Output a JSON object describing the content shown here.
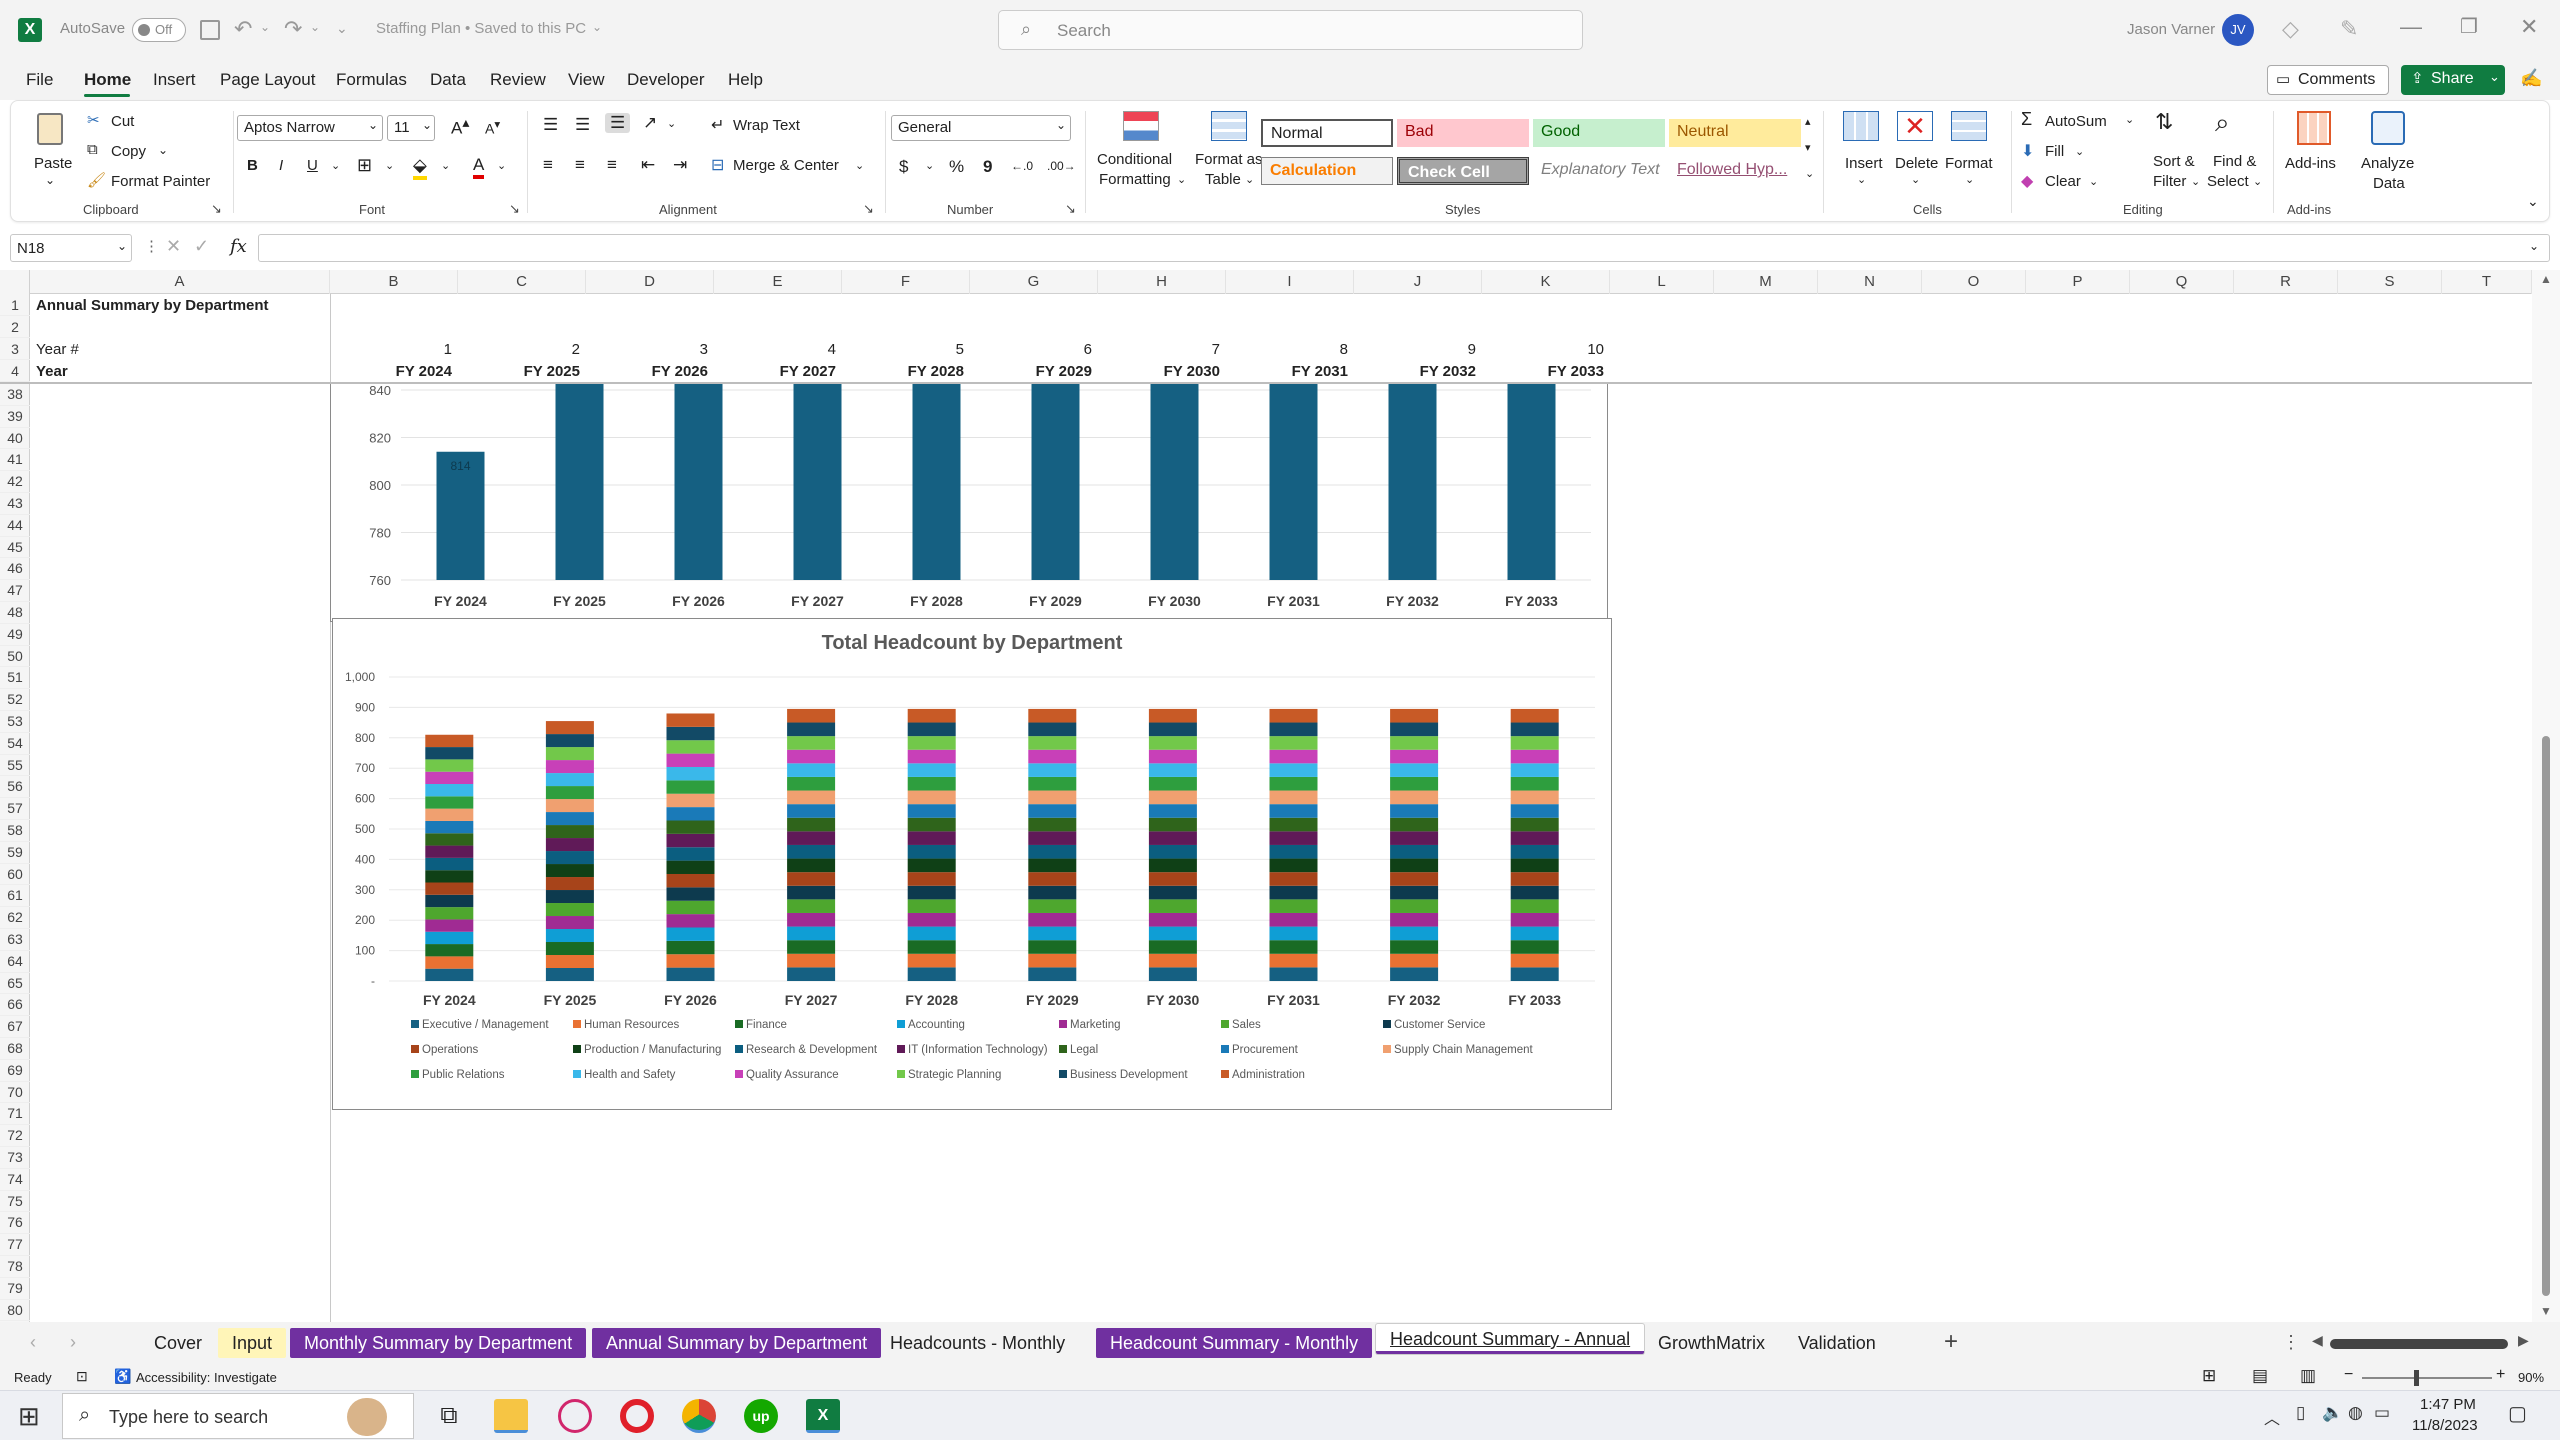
{
  "titlebar": {
    "autosave_label": "AutoSave",
    "autosave_state": "Off",
    "doc_title": "Staffing Plan • Saved to this PC",
    "search_placeholder": "Search",
    "user_name": "Jason Varner",
    "user_initials": "JV"
  },
  "menu": {
    "items": [
      "File",
      "Home",
      "Insert",
      "Page Layout",
      "Formulas",
      "Data",
      "Review",
      "View",
      "Developer",
      "Help"
    ],
    "active": "Home",
    "comments_label": "Comments",
    "share_label": "Share"
  },
  "ribbon": {
    "clipboard": {
      "group": "Clipboard",
      "paste": "Paste",
      "cut": "Cut",
      "copy": "Copy",
      "format_painter": "Format Painter"
    },
    "font": {
      "group": "Font",
      "font_name": "Aptos Narrow",
      "font_size": "11"
    },
    "alignment": {
      "group": "Alignment",
      "wrap_text": "Wrap Text",
      "merge_center": "Merge & Center"
    },
    "number": {
      "group": "Number",
      "format": "General"
    },
    "styles": {
      "group": "Styles",
      "conditional_1": "Conditional",
      "conditional_2": "Formatting",
      "format_table_1": "Format as",
      "format_table_2": "Table",
      "cells": [
        {
          "label": "Normal",
          "bg": "#ffffff",
          "fg": "#000000"
        },
        {
          "label": "Bad",
          "bg": "#ffc7ce",
          "fg": "#9c0006"
        },
        {
          "label": "Good",
          "bg": "#c6efce",
          "fg": "#006100"
        },
        {
          "label": "Neutral",
          "bg": "#ffeb9c",
          "fg": "#9c5700"
        },
        {
          "label": "Calculation",
          "bg": "#f2f2f2",
          "fg": "#fa7d00"
        },
        {
          "label": "Check Cell",
          "bg": "#a5a5a5",
          "fg": "#ffffff"
        },
        {
          "label": "Explanatory Text",
          "bg": "#ffffff",
          "fg": "#7f7f7f"
        },
        {
          "label": "Followed Hyp...",
          "bg": "#ffffff",
          "fg": "#954f72"
        }
      ]
    },
    "cells": {
      "group": "Cells",
      "insert": "Insert",
      "delete": "Delete",
      "format": "Format"
    },
    "editing": {
      "group": "Editing",
      "autosum": "AutoSum",
      "fill": "Fill",
      "clear": "Clear",
      "sort_1": "Sort &",
      "sort_2": "Filter",
      "find_1": "Find &",
      "find_2": "Select"
    },
    "addins": {
      "group": "Add-ins",
      "addins": "Add-ins",
      "analyze_1": "Analyze",
      "analyze_2": "Data"
    }
  },
  "formula_bar": {
    "name_box": "N18",
    "fx": "fx",
    "formula": ""
  },
  "grid": {
    "columns": [
      "A",
      "B",
      "C",
      "D",
      "E",
      "F",
      "G",
      "H",
      "I",
      "J",
      "K",
      "L",
      "M",
      "N",
      "O",
      "P",
      "Q",
      "R",
      "S",
      "T"
    ],
    "frozen_rows": [
      {
        "row": "1",
        "a": "Annual Summary by Department"
      },
      {
        "row": "2",
        "a": ""
      },
      {
        "row": "3",
        "a": "Year #"
      },
      {
        "row": "4",
        "a": "Year"
      }
    ],
    "year_numbers": [
      "1",
      "2",
      "3",
      "4",
      "5",
      "6",
      "7",
      "8",
      "9",
      "10"
    ],
    "years": [
      "FY 2024",
      "FY 2025",
      "FY 2026",
      "FY 2027",
      "FY 2028",
      "FY 2029",
      "FY 2030",
      "FY 2031",
      "FY 2032",
      "FY 2033"
    ],
    "scroll_rows": [
      "38",
      "39",
      "40",
      "41",
      "42",
      "43",
      "44",
      "45",
      "46",
      "47",
      "48",
      "49",
      "50",
      "51",
      "52",
      "53",
      "54",
      "55",
      "56",
      "57",
      "58",
      "59",
      "60",
      "61",
      "62",
      "63",
      "64",
      "65",
      "66",
      "67",
      "68",
      "69",
      "70",
      "71",
      "72",
      "73",
      "74",
      "75",
      "76",
      "77",
      "78",
      "79",
      "80"
    ]
  },
  "chart_data": [
    {
      "type": "bar",
      "title": "",
      "categories": [
        "FY 2024",
        "FY 2025",
        "FY 2026",
        "FY 2027",
        "FY 2028",
        "FY 2029",
        "FY 2030",
        "FY 2031",
        "FY 2032",
        "FY 2033"
      ],
      "values": [
        814,
        850,
        850,
        850,
        850,
        850,
        850,
        850,
        850,
        850
      ],
      "ylim": [
        760,
        840
      ],
      "yticks": [
        "760",
        "780",
        "800",
        "820",
        "840"
      ],
      "color": "#156082",
      "data_label_first": "814"
    },
    {
      "type": "bar",
      "stacked": true,
      "title": "Total Headcount by Department",
      "categories": [
        "FY 2024",
        "FY 2025",
        "FY 2026",
        "FY 2027",
        "FY 2028",
        "FY 2029",
        "FY 2030",
        "FY 2031",
        "FY 2032",
        "FY 2033"
      ],
      "totals": [
        810,
        855,
        880,
        895,
        895,
        895,
        895,
        895,
        895,
        895
      ],
      "ylim": [
        0,
        1000
      ],
      "yticks": [
        "-",
        "100",
        "200",
        "300",
        "400",
        "500",
        "600",
        "700",
        "800",
        "900",
        "1,000"
      ],
      "legend_position": "bottom",
      "series": [
        {
          "name": "Executive / Management",
          "color": "#156082"
        },
        {
          "name": "Human Resources",
          "color": "#e97132"
        },
        {
          "name": "Finance",
          "color": "#196b24"
        },
        {
          "name": "Accounting",
          "color": "#0f9ed5"
        },
        {
          "name": "Marketing",
          "color": "#a02b93"
        },
        {
          "name": "Sales",
          "color": "#4ea72e"
        },
        {
          "name": "Customer Service",
          "color": "#0d3a4e"
        },
        {
          "name": "Operations",
          "color": "#a7441a"
        },
        {
          "name": "Production / Manufacturing",
          "color": "#0f4016"
        },
        {
          "name": "Research & Development",
          "color": "#0b5e80"
        },
        {
          "name": "IT (Information Technology)",
          "color": "#601a58"
        },
        {
          "name": "Legal",
          "color": "#2f641b"
        },
        {
          "name": "Procurement",
          "color": "#1a7ab8"
        },
        {
          "name": "Supply Chain Management",
          "color": "#f0a070"
        },
        {
          "name": "Public Relations",
          "color": "#2e9e3e"
        },
        {
          "name": "Health and Safety",
          "color": "#3ab8ea"
        },
        {
          "name": "Quality Assurance",
          "color": "#c840b8"
        },
        {
          "name": "Strategic Planning",
          "color": "#72c84a"
        },
        {
          "name": "Business Development",
          "color": "#124a66"
        },
        {
          "name": "Administration",
          "color": "#c85a26"
        }
      ]
    }
  ],
  "sheet_tabs": [
    {
      "label": "Cover",
      "style": "plain"
    },
    {
      "label": "Input",
      "style": "yellow"
    },
    {
      "label": "Monthly Summary by Department",
      "style": "purple"
    },
    {
      "label": "Annual Summary by Department",
      "style": "purple"
    },
    {
      "label": "Headcounts - Monthly",
      "style": "plain"
    },
    {
      "label": "Headcount Summary - Monthly",
      "style": "purple"
    },
    {
      "label": "Headcount Summary - Annual",
      "style": "active"
    },
    {
      "label": "GrowthMatrix",
      "style": "plain"
    },
    {
      "label": "Validation",
      "style": "plain"
    }
  ],
  "status": {
    "ready": "Ready",
    "accessibility": "Accessibility: Investigate",
    "zoom": "90%"
  },
  "taskbar": {
    "search_placeholder": "Type here to search",
    "time": "1:47 PM",
    "date": "11/8/2023"
  }
}
